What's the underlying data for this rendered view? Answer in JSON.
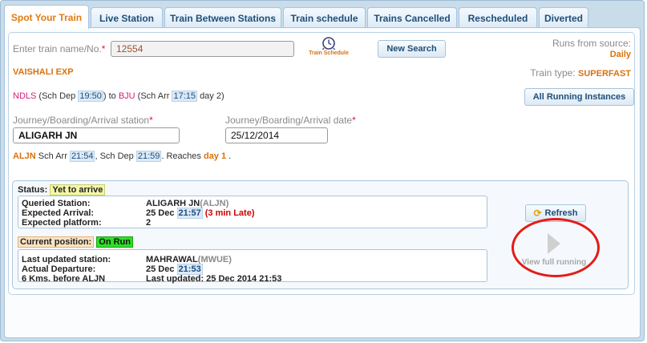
{
  "tabs": [
    {
      "label": "Spot Your Train"
    },
    {
      "label": "Live Station"
    },
    {
      "label": "Train Between Stations"
    },
    {
      "label": "Train schedule"
    },
    {
      "label": "Trains Cancelled"
    },
    {
      "label": "Rescheduled"
    },
    {
      "label": "Diverted"
    }
  ],
  "search": {
    "label": "Enter train name/No.",
    "required_mark": "*",
    "value": "12554",
    "schedule_link": "Train Schedule",
    "new_search": "New Search",
    "runs_label": "Runs from source:",
    "runs_value": "Daily"
  },
  "train": {
    "name": "VAISHALI EXP",
    "type_label": "Train type:",
    "type_value": "SUPERFAST",
    "from_code": "NDLS",
    "sch_dep_label": "(Sch Dep",
    "sch_dep": "19:50",
    "to_word": ") to",
    "to_code": "BJU",
    "sch_arr_label": "(Sch Arr",
    "sch_arr": "17:15",
    "day_text": "day 2)",
    "all_instances": "All Running Instances"
  },
  "journey": {
    "station_label": "Journey/Boarding/Arrival station",
    "station_value": "ALIGARH JN",
    "date_label": "Journey/Boarding/Arrival date",
    "date_value": "25/12/2014",
    "code": "ALJN",
    "arr_label": "Sch Arr",
    "arr": "21:54",
    "dep_label": ", Sch Dep",
    "dep": "21:59",
    "reaches": ". Reaches",
    "day": "day 1",
    "dot": "."
  },
  "status": {
    "label": "Status:",
    "value": "Yet to arrive",
    "queried_label": "Queried Station:",
    "queried_name": "ALIGARH JN",
    "queried_code": "(ALJN)",
    "expected_arrival_label": "Expected Arrival:",
    "expected_arrival_date": "25 Dec",
    "expected_arrival_time": "21:57",
    "late_text": "(3 min Late)",
    "platform_label": "Expected platform:",
    "platform_value": "2"
  },
  "position": {
    "label": "Current position:",
    "value": "On Run",
    "last_station_label": "Last updated station:",
    "last_station_name": "MAHRAWAL",
    "last_station_code": "(MWUE)",
    "departure_label": "Actual Departure:",
    "departure_date": "25 Dec",
    "departure_time": "21:53",
    "kms_text": "6 Kms. before ALJN",
    "last_updated": "Last updated: 25 Dec 2014 21:53"
  },
  "actions": {
    "refresh": "Refresh",
    "view_full": "View full running"
  },
  "colors": {
    "accent_orange": "#e07a12",
    "highlight_red": "#e41b17",
    "on_run_green": "#2ee026"
  }
}
